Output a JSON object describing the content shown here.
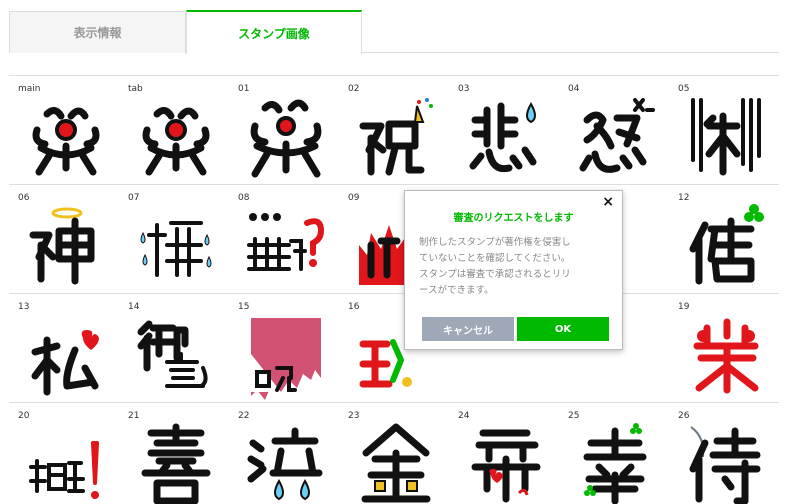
{
  "tabs": {
    "info_label": "表示情報",
    "image_label": "スタンプ画像"
  },
  "stickers": [
    {
      "label": "main",
      "char": "笑"
    },
    {
      "label": "tab",
      "char": "笑"
    },
    {
      "label": "01",
      "char": "笑"
    },
    {
      "label": "02",
      "char": "祝"
    },
    {
      "label": "03",
      "char": "悲"
    },
    {
      "label": "04",
      "char": "怒"
    },
    {
      "label": "05",
      "char": "冷"
    },
    {
      "label": "06",
      "char": "神"
    },
    {
      "label": "07",
      "char": "焦"
    },
    {
      "label": "08",
      "char": "無視"
    },
    {
      "label": "09",
      "char": "燃"
    },
    {
      "label": "12",
      "char": "俺"
    },
    {
      "label": "13",
      "char": "私"
    },
    {
      "label": "14",
      "char": "御意"
    },
    {
      "label": "15",
      "char": "呪"
    },
    {
      "label": "16",
      "char": "珍"
    },
    {
      "label": "19",
      "char": "楽"
    },
    {
      "label": "20",
      "char": "頑張"
    },
    {
      "label": "21",
      "char": "喜"
    },
    {
      "label": "22",
      "char": "泣"
    },
    {
      "label": "23",
      "char": "金"
    },
    {
      "label": "24",
      "char": "愛"
    },
    {
      "label": "25",
      "char": "幸"
    },
    {
      "label": "26",
      "char": "侍"
    }
  ],
  "modal": {
    "close_symbol": "×",
    "title": "審査のリクエストをします",
    "body_line1": "制作したスタンプが著作権を侵害し",
    "body_line2": "ていないことを確認してください。",
    "body_line3": "スタンプは審査で承認されるとリリ",
    "body_line4": "ースができます。",
    "cancel_label": "キャンセル",
    "ok_label": "OK"
  },
  "colors": {
    "accent": "#00b900",
    "cancel": "#9ea8b6",
    "red": "#e0161b"
  }
}
